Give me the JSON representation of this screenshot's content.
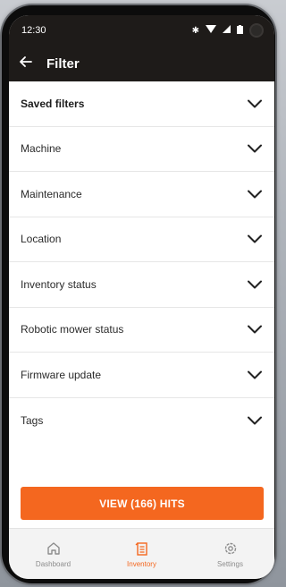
{
  "status_bar": {
    "time": "12:30",
    "icons": [
      "bluetooth-icon",
      "wifi-icon",
      "signal-icon",
      "battery-icon",
      "camera-icon"
    ]
  },
  "header": {
    "back_icon": "arrow-left-icon",
    "title": "Filter"
  },
  "filters": [
    {
      "label": "Saved filters"
    },
    {
      "label": "Machine"
    },
    {
      "label": "Maintenance"
    },
    {
      "label": "Location"
    },
    {
      "label": "Inventory status"
    },
    {
      "label": "Robotic mower status"
    },
    {
      "label": "Firmware update"
    },
    {
      "label": "Tags"
    }
  ],
  "cta": {
    "label": "VIEW (166) HITS"
  },
  "tabs": [
    {
      "label": "Dashboard",
      "icon": "home-icon",
      "active": false
    },
    {
      "label": "Inventory",
      "icon": "inventory-icon",
      "active": true
    },
    {
      "label": "Settings",
      "icon": "gear-icon",
      "active": false
    }
  ],
  "colors": {
    "accent": "#f4671f",
    "header_bg": "#1e1b19"
  }
}
